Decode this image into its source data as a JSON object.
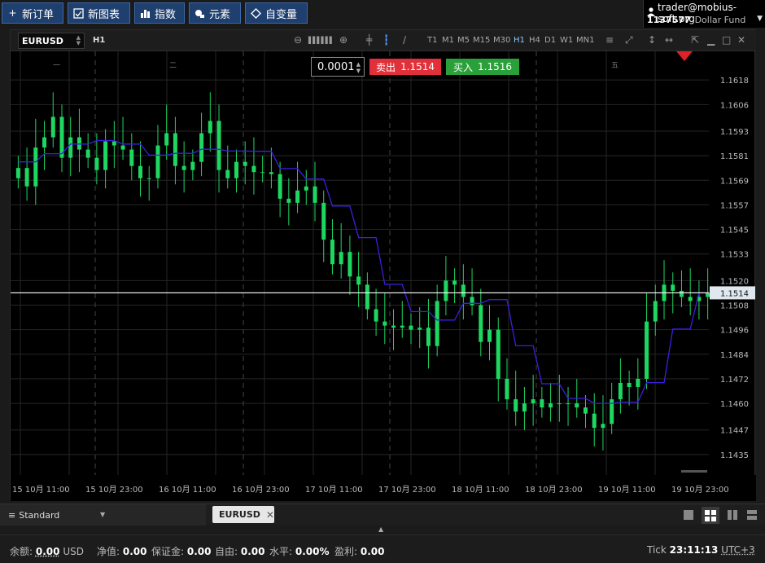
{
  "toolbar": {
    "new_order": "新订单",
    "new_chart": "新图表",
    "indicators": "指数",
    "elements": "元素",
    "variables": "自变量"
  },
  "account": {
    "email": "trader@mobius-soft.org",
    "id": "1137577",
    "fund": "Dollar Fund"
  },
  "chart": {
    "symbol": "EURUSD",
    "timeframe": "H1",
    "timeframes": [
      "T1",
      "M1",
      "M5",
      "M15",
      "M30",
      "H1",
      "H4",
      "D1",
      "W1",
      "MN1"
    ],
    "active_timeframe": "H1",
    "lot": "0.0001",
    "sell_label": "卖出",
    "sell_price": "1.1514",
    "buy_label": "买入",
    "buy_price": "1.1516",
    "current_price_label": "1.1514",
    "day_markers": [
      "一",
      "二",
      "五"
    ],
    "colors": {
      "bull": "#1ed760",
      "bear": "#1ed760",
      "ma": "#3c1fe0",
      "price_line": "#ffffff",
      "sell": "#e2303a",
      "buy": "#2aa03a"
    }
  },
  "chart_data": {
    "type": "candlestick",
    "y_ticks": [
      "1.1618",
      "1.1606",
      "1.1593",
      "1.1581",
      "1.1569",
      "1.1557",
      "1.1545",
      "1.1533",
      "1.1520",
      "1.1508",
      "1.1496",
      "1.1484",
      "1.1472",
      "1.1460",
      "1.1447",
      "1.1435"
    ],
    "x_ticks": [
      "15 10月 11:00",
      "15 10月 23:00",
      "16 10月 11:00",
      "16 10月 23:00",
      "17 10月 11:00",
      "17 10月 23:00",
      "18 10月 11:00",
      "18 10月 23:00",
      "19 10月 11:00",
      "19 10月 23:00"
    ],
    "ylim": [
      1.1425,
      1.1632
    ],
    "current_price": 1.1514,
    "closes": [
      1.1575,
      1.1566,
      1.1585,
      1.159,
      1.16,
      1.158,
      1.159,
      1.1584,
      1.158,
      1.1574,
      1.1588,
      1.1586,
      1.1584,
      1.1576,
      1.157,
      1.157,
      1.1586,
      1.1592,
      1.1576,
      1.1574,
      1.1578,
      1.1592,
      1.1598,
      1.1574,
      1.157,
      1.1578,
      1.1576,
      1.1573,
      1.1573,
      1.1572,
      1.156,
      1.1558,
      1.1564,
      1.1566,
      1.1558,
      1.154,
      1.1528,
      1.1534,
      1.1522,
      1.1518,
      1.1506,
      1.15,
      1.1498,
      1.1497,
      1.1498,
      1.1496,
      1.1497,
      1.1488,
      1.151,
      1.152,
      1.1518,
      1.1512,
      1.1508,
      1.149,
      1.1496,
      1.1472,
      1.1462,
      1.1456,
      1.146,
      1.1462,
      1.1458,
      1.146,
      1.146,
      1.146,
      1.1458,
      1.1455,
      1.1448,
      1.145,
      1.1462,
      1.147,
      1.1468,
      1.1472,
      1.15,
      1.151,
      1.1518,
      1.1515,
      1.1512,
      1.151,
      1.1512,
      1.1514
    ],
    "moving_average": "blue step line trailing price",
    "grid": true
  },
  "bottom": {
    "layout_name": "Standard",
    "tab_symbol": "EURUSD"
  },
  "status": {
    "balance_label": "余额:",
    "balance_value": "0.00",
    "balance_ccy": "USD",
    "equity_label": "净值:",
    "equity_value": "0.00",
    "margin_label": "保证金:",
    "margin_value": "0.00",
    "free_label": "自由:",
    "free_value": "0.00",
    "level_label": "水平:",
    "level_value": "0.00%",
    "profit_label": "盈利:",
    "profit_value": "0.00",
    "tick_label": "Tick",
    "time": "23:11:13",
    "tz": "UTC+3"
  }
}
